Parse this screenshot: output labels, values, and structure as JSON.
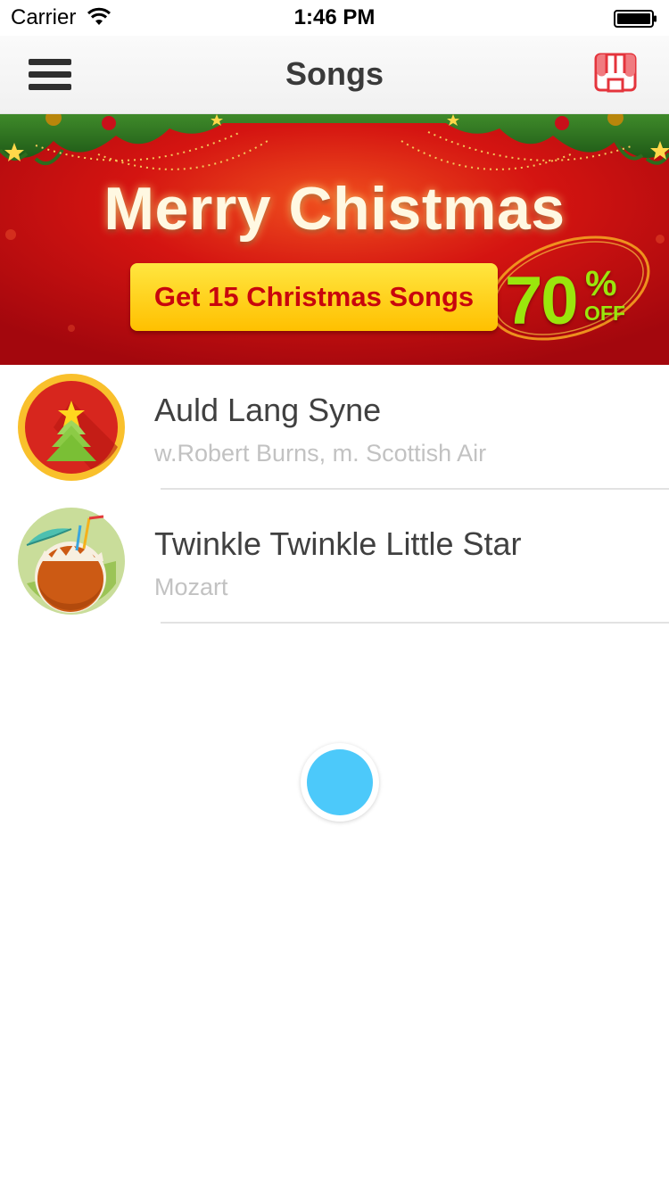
{
  "status_bar": {
    "carrier": "Carrier",
    "time": "1:46 PM"
  },
  "nav": {
    "title": "Songs",
    "menu_icon": "hamburger-menu-icon",
    "store_icon": "store-icon"
  },
  "banner": {
    "title": "Merry Chistmas",
    "cta": "Get 15 Christmas Songs",
    "discount_number": "70",
    "discount_sign": "%",
    "discount_off": "OFF"
  },
  "songs": [
    {
      "title": "Auld Lang Syne",
      "subtitle": "w.Robert Burns, m. Scottish Air",
      "icon": "christmas-tree-icon"
    },
    {
      "title": "Twinkle Twinkle Little Star",
      "subtitle": "Mozart",
      "icon": "coconut-drink-icon"
    }
  ],
  "colors": {
    "accent_blue": "#4cc9fa",
    "banner_red": "#c8050d",
    "discount_green": "#9ae60c"
  }
}
